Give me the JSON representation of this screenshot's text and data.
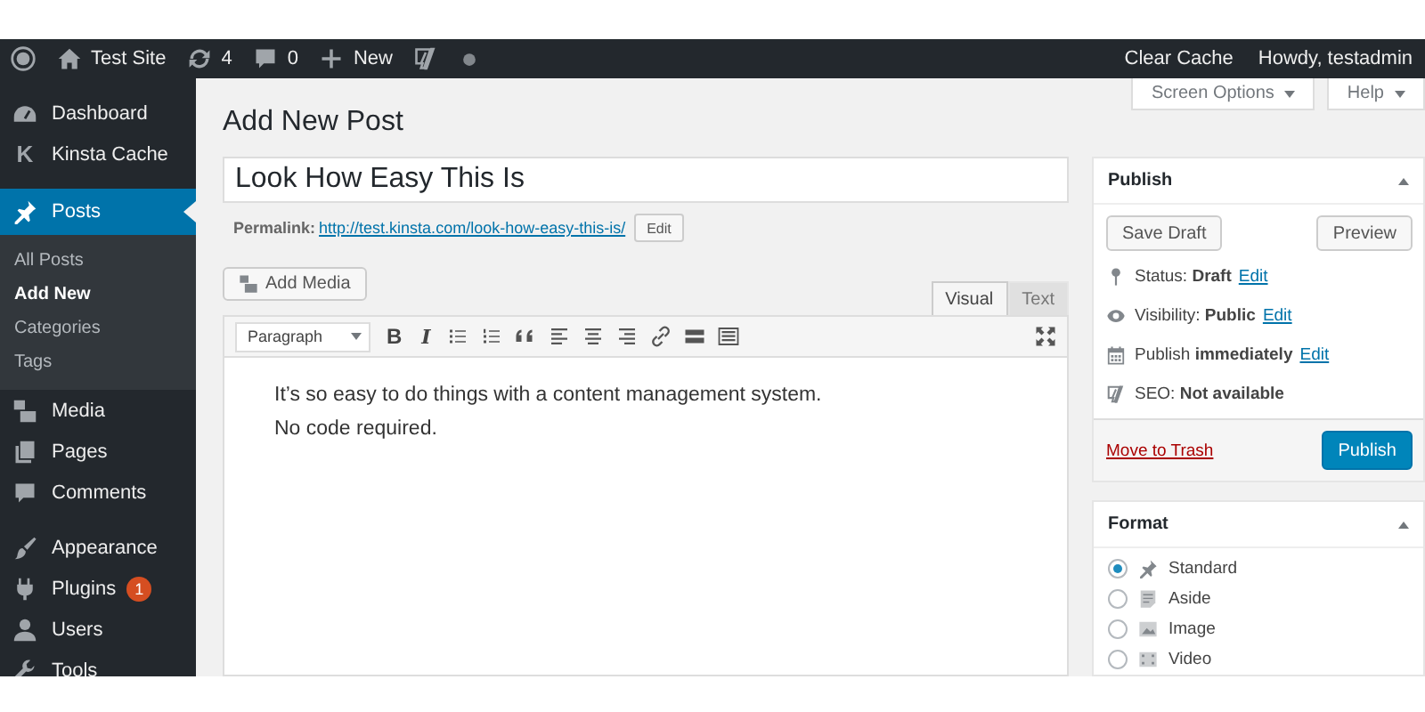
{
  "admin_bar": {
    "left": [
      {
        "kind": "logo"
      },
      {
        "kind": "home",
        "label": "Test Site"
      },
      {
        "kind": "updates",
        "label": "4"
      },
      {
        "kind": "comments",
        "label": "0"
      },
      {
        "kind": "new",
        "label": "New"
      },
      {
        "kind": "seo"
      },
      {
        "kind": "dot"
      }
    ],
    "right": [
      "Clear Cache",
      "Howdy, testadmin"
    ]
  },
  "sidebar": {
    "items": [
      {
        "label": "Dashboard",
        "selected": false
      },
      {
        "glyph": "K",
        "label": "Kinsta Cache",
        "selected": false
      },
      {
        "label": "Posts",
        "selected": true,
        "children": [
          {
            "label": "All Posts",
            "selected": false
          },
          {
            "label": "Add New",
            "selected": true
          },
          {
            "label": "Categories",
            "selected": false
          },
          {
            "label": "Tags",
            "selected": false
          }
        ]
      },
      {
        "label": "Media",
        "selected": false
      },
      {
        "label": "Pages",
        "selected": false
      },
      {
        "label": "Comments",
        "selected": false
      },
      {
        "label": "Appearance",
        "selected": false
      },
      {
        "label": "Plugins",
        "selected": false,
        "badge": "1"
      },
      {
        "label": "Users",
        "selected": false
      },
      {
        "label": "Tools",
        "selected": false
      }
    ]
  },
  "screen_tabs": [
    "Screen Options",
    "Help"
  ],
  "page_title": "Add New Post",
  "post_title": "Look How Easy This Is",
  "permalink": {
    "label": "Permalink:",
    "url": "http://test.kinsta.com/look-how-easy-this-is/",
    "button": "Edit"
  },
  "add_media": "Add Media",
  "editor_tabs": [
    {
      "label": "Visual",
      "selected": true
    },
    {
      "label": "Text",
      "selected": false
    }
  ],
  "toolbar": {
    "format": "Paragraph",
    "tools": [
      {
        "kind": "bold",
        "label": "B"
      },
      {
        "kind": "italic",
        "label": "I"
      },
      {
        "kind": "bullets"
      },
      {
        "kind": "numbers"
      },
      {
        "kind": "quote"
      },
      {
        "kind": "left"
      },
      {
        "kind": "center"
      },
      {
        "kind": "right"
      },
      {
        "kind": "link"
      },
      {
        "kind": "more"
      },
      {
        "kind": "toggle"
      }
    ]
  },
  "content": "It’s so easy to do things with a content management system. No code required.",
  "publish": {
    "title": "Publish",
    "save": "Save Draft",
    "preview": "Preview",
    "rows": [
      {
        "kind": "status",
        "text": "Status: **Draft**",
        "link": "Edit"
      },
      {
        "kind": "visibility",
        "text": "Visibility: **Public**",
        "link": "Edit"
      },
      {
        "kind": "schedule",
        "text": "Publish **immediately**",
        "link": "Edit"
      },
      {
        "kind": "seo",
        "text": "SEO: **Not available**"
      }
    ],
    "trash": "Move to Trash",
    "submit": "Publish"
  },
  "format": {
    "title": "Format",
    "options": [
      {
        "label": "Standard",
        "selected": true
      },
      {
        "label": "Aside",
        "selected": false
      },
      {
        "label": "Image",
        "selected": false
      },
      {
        "label": "Video",
        "selected": false
      }
    ]
  }
}
